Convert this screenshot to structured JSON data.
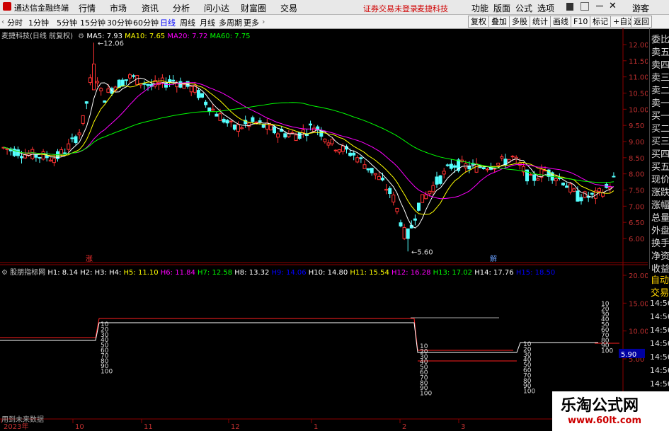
{
  "app": {
    "title": "通达信金融终端"
  },
  "menu": [
    "行情",
    "市场",
    "资讯",
    "分析",
    "问小达",
    "财富圈",
    "交易"
  ],
  "menu_notice": [
    "证券交易未登录",
    "麦捷科技"
  ],
  "menu_right": [
    "功能",
    "版面",
    "公式",
    "选项",
    "游客"
  ],
  "toolbar": {
    "periods": [
      "分时",
      "1分钟",
      "5分钟",
      "15分钟",
      "30分钟",
      "60分钟",
      "日线",
      "周线",
      "月线",
      "多周期",
      "更多"
    ],
    "active": "日线",
    "buttons_right": [
      "复权",
      "叠加",
      "多股",
      "统计",
      "画线",
      "F10",
      "标记",
      "+自选",
      "返回"
    ]
  },
  "stock_info": {
    "name": "麦捷科技(日线 前复权)",
    "ma": [
      {
        "label": "MA5: 7.93",
        "color": "#ffffff"
      },
      {
        "label": "MA10: 7.65",
        "color": "#ffff00"
      },
      {
        "label": "MA20: 7.72",
        "color": "#ff00ff"
      },
      {
        "label": "MA60: 7.75",
        "color": "#00ff00"
      }
    ],
    "high_label": "12.06",
    "low_label": "5.60",
    "marks": [
      "涨",
      "解"
    ]
  },
  "indicator": {
    "name": "股朋指标网",
    "fields": [
      {
        "label": "H1: 8.14",
        "color": "#ffffff"
      },
      {
        "label": "H2:",
        "color": "#ffffff"
      },
      {
        "label": "H3:",
        "color": "#ffffff"
      },
      {
        "label": "H4:",
        "color": "#ffffff"
      },
      {
        "label": "H5: 11.10",
        "color": "#ffff00"
      },
      {
        "label": "H6: 11.84",
        "color": "#ff00ff"
      },
      {
        "label": "H7: 12.58",
        "color": "#00ff00"
      },
      {
        "label": "H8: 13.32",
        "color": "#ffffff"
      },
      {
        "label": "H9: 14.06",
        "color": "#0000ff"
      },
      {
        "label": "H10: 14.80",
        "color": "#ffffff"
      },
      {
        "label": "H11: 15.54",
        "color": "#ffff00"
      },
      {
        "label": "H12: 16.28",
        "color": "#ff00ff"
      },
      {
        "label": "H13: 17.02",
        "color": "#00ff00"
      },
      {
        "label": "H14: 17.76",
        "color": "#ffffff"
      },
      {
        "label": "H15: 18.50",
        "color": "#0000ff"
      }
    ],
    "current_value": "5.90",
    "ladder_labels": [
      "10",
      "20",
      "30",
      "40",
      "50",
      "60",
      "70",
      "80",
      "90",
      "100"
    ],
    "footer": "用到未来数据"
  },
  "price_axis": [
    "12.00",
    "11.50",
    "11.00",
    "10.50",
    "10.00",
    "9.50",
    "9.00",
    "8.50",
    "8.00",
    "7.50",
    "7.00",
    "6.50",
    "6.00"
  ],
  "indicator_axis": [
    "20.00",
    "15.00",
    "10.00",
    "5.00"
  ],
  "time_axis": [
    "2023年",
    "10",
    "11",
    "12",
    "1",
    "2",
    "3"
  ],
  "right_panel": {
    "labels": [
      "委比",
      "卖五",
      "卖四",
      "卖三",
      "卖二",
      "卖一",
      "买一",
      "买二",
      "买三",
      "买四",
      "买五",
      "现价",
      "涨跌",
      "涨幅",
      "总量",
      "外盘",
      "换手",
      "净资",
      "收益"
    ],
    "bottom": [
      "自动",
      "交易"
    ],
    "times": [
      "14:56",
      "14:56",
      "14:56",
      "14:56",
      "14:56",
      "14:56",
      "14:56"
    ]
  },
  "watermark": {
    "title": "乐淘公式网",
    "url": "www.60lt.com"
  }
}
